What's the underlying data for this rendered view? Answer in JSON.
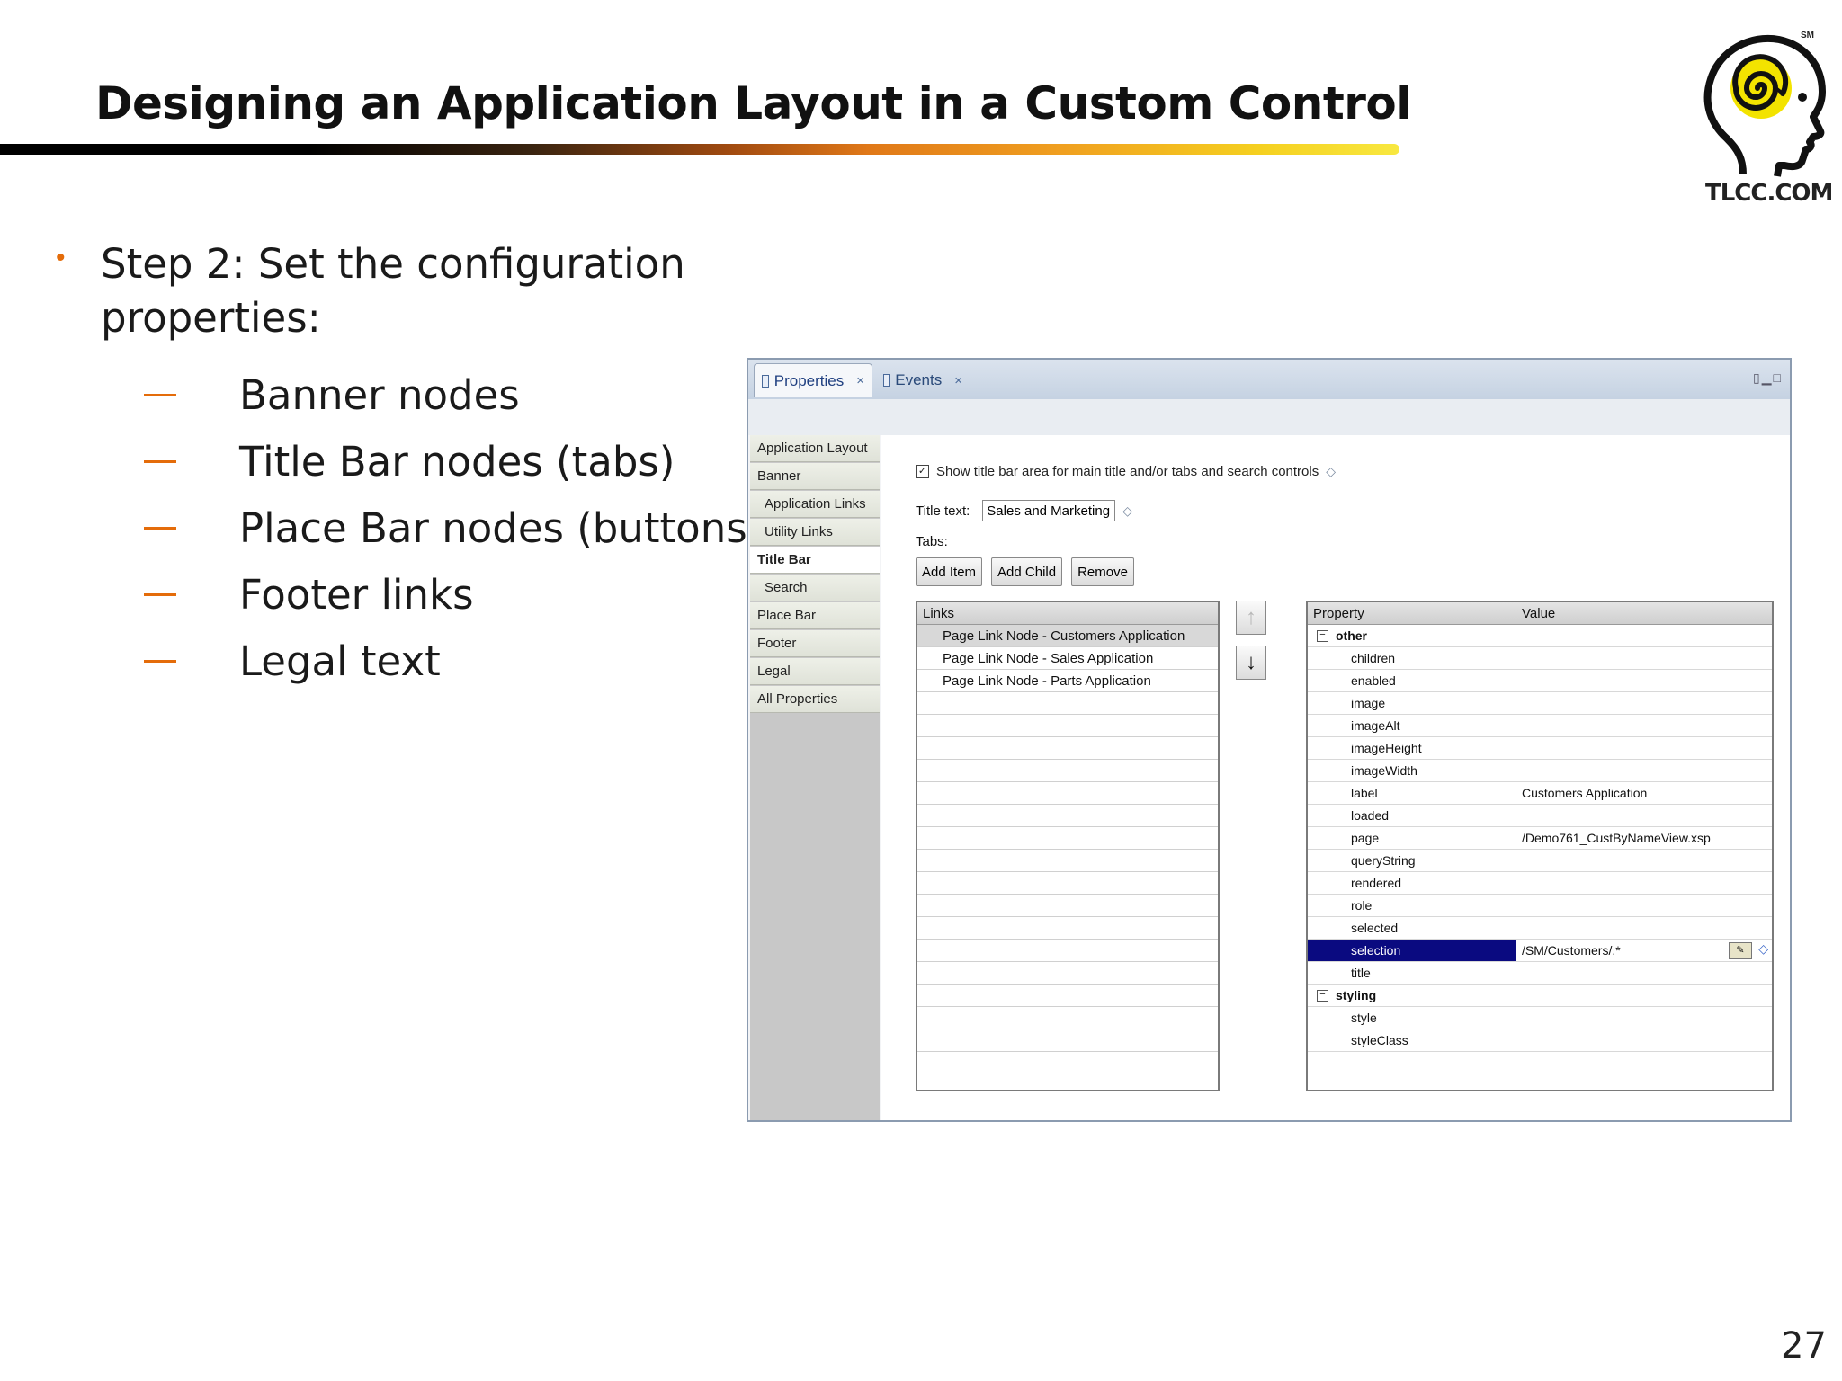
{
  "slide": {
    "title": "Designing an Application Layout in a Custom Control",
    "step": "Step 2:  Set the configuration properties:",
    "subitems": [
      "Banner nodes",
      "Title Bar nodes (tabs)",
      "Place Bar nodes (buttons)",
      "Footer links",
      "Legal text"
    ],
    "page_number": "27",
    "logo_text": "TLCC.COM",
    "logo_mark": "SM"
  },
  "panel": {
    "tabs": [
      {
        "label": "Properties",
        "close": "×"
      },
      {
        "label": "Events",
        "close": "×"
      }
    ],
    "nav": [
      "Application Layout",
      "Banner",
      "Application Links",
      "Utility Links",
      "Title Bar",
      "Search",
      "Place Bar",
      "Footer",
      "Legal",
      "All Properties"
    ],
    "show_title_bar": {
      "checked_mark": "✓",
      "label": "Show title bar area for main title and/or tabs and search controls"
    },
    "title_text_label": "Title text:",
    "title_text_value": "Sales and Marketing",
    "tabs_label": "Tabs:",
    "buttons": {
      "add_item": "Add Item",
      "add_child": "Add Child",
      "remove": "Remove"
    },
    "links": {
      "header": "Links",
      "rows": [
        "Page Link Node - Customers Application",
        "Page Link Node - Sales Application",
        "Page Link Node - Parts Application"
      ]
    },
    "props": {
      "header_property": "Property",
      "header_value": "Value",
      "group_other": "other",
      "other_rows": [
        {
          "name": "children",
          "value": ""
        },
        {
          "name": "enabled",
          "value": ""
        },
        {
          "name": "image",
          "value": ""
        },
        {
          "name": "imageAlt",
          "value": ""
        },
        {
          "name": "imageHeight",
          "value": ""
        },
        {
          "name": "imageWidth",
          "value": ""
        },
        {
          "name": "label",
          "value": "Customers Application"
        },
        {
          "name": "loaded",
          "value": ""
        },
        {
          "name": "page",
          "value": "/Demo761_CustByNameView.xsp"
        },
        {
          "name": "queryString",
          "value": ""
        },
        {
          "name": "rendered",
          "value": ""
        },
        {
          "name": "role",
          "value": ""
        },
        {
          "name": "selected",
          "value": ""
        },
        {
          "name": "selection",
          "value": "/SM/Customers/.*"
        },
        {
          "name": "title",
          "value": ""
        }
      ],
      "group_styling": "styling",
      "styling_rows": [
        {
          "name": "style",
          "value": ""
        },
        {
          "name": "styleClass",
          "value": ""
        }
      ]
    }
  }
}
